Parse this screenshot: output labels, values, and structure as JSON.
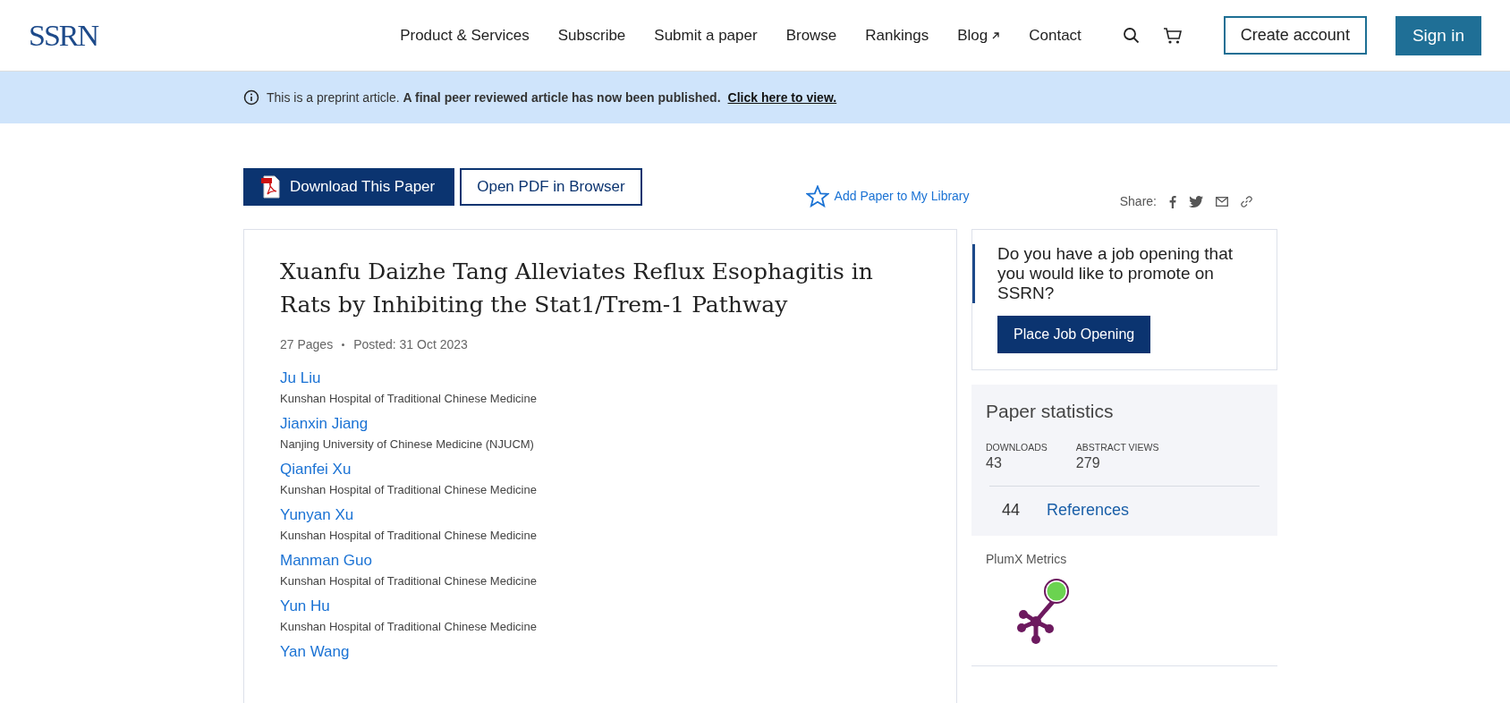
{
  "header": {
    "logo": "SSRN",
    "nav": [
      {
        "label": "Product & Services",
        "external": false
      },
      {
        "label": "Subscribe",
        "external": false
      },
      {
        "label": "Submit a paper",
        "external": false
      },
      {
        "label": "Browse",
        "external": false
      },
      {
        "label": "Rankings",
        "external": false
      },
      {
        "label": "Blog",
        "external": true
      },
      {
        "label": "Contact",
        "external": false
      }
    ],
    "create_account": "Create account",
    "sign_in": "Sign in"
  },
  "banner": {
    "text": "This is a preprint article. **A final peer reviewed article has now been published.**",
    "link": "Click here to view."
  },
  "actions": {
    "download": "Download This Paper",
    "open_pdf": "Open PDF in Browser",
    "add_library": "Add Paper to My Library",
    "share_label": "Share:"
  },
  "paper": {
    "title": "Xuanfu Daizhe Tang Alleviates Reflux Esophagitis in Rats by Inhibiting the Stat1/Trem-1 Pathway",
    "pages": "27 Pages",
    "posted": "Posted: 31 Oct 2023",
    "authors": [
      {
        "name": "Ju Liu",
        "affiliation": "Kunshan Hospital of Traditional Chinese Medicine"
      },
      {
        "name": "Jianxin Jiang",
        "affiliation": "Nanjing University of Chinese Medicine (NJUCM)"
      },
      {
        "name": "Qianfei Xu",
        "affiliation": "Kunshan Hospital of Traditional Chinese Medicine"
      },
      {
        "name": "Yunyan Xu",
        "affiliation": "Kunshan Hospital of Traditional Chinese Medicine"
      },
      {
        "name": "Manman Guo",
        "affiliation": "Kunshan Hospital of Traditional Chinese Medicine"
      },
      {
        "name": "Yun Hu",
        "affiliation": "Kunshan Hospital of Traditional Chinese Medicine"
      },
      {
        "name": "Yan Wang"
      }
    ]
  },
  "job_card": {
    "question": "Do you have a job opening that you would like to promote on SSRN?",
    "button": "Place Job Opening"
  },
  "statistics": {
    "title": "Paper statistics",
    "stats": [
      {
        "label": "DOWNLOADS",
        "value": "43"
      },
      {
        "label": "ABSTRACT VIEWS",
        "value": "279"
      }
    ],
    "references_count": "44",
    "references_label": "References"
  },
  "plumx": {
    "title": "PlumX Metrics"
  }
}
